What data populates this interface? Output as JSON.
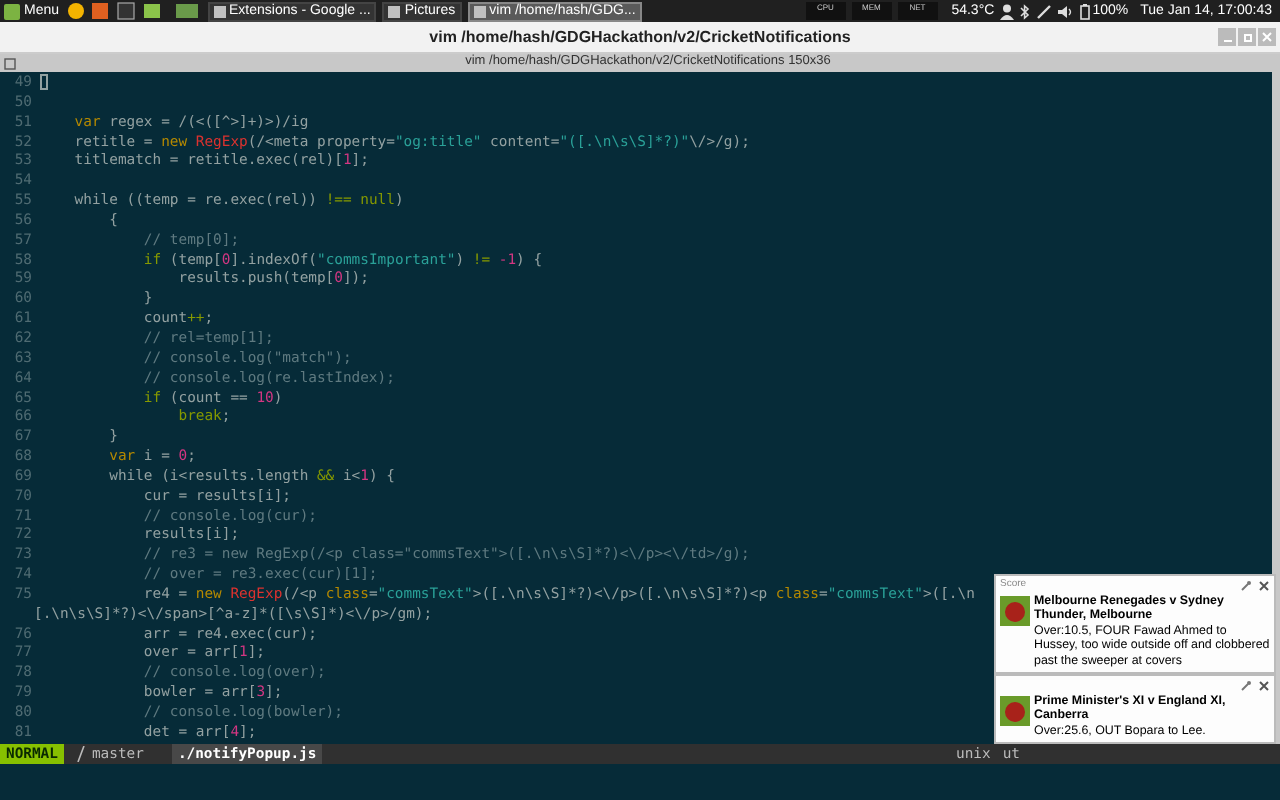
{
  "taskbar": {
    "menu": "Menu",
    "tasks": [
      {
        "label": "Extensions - Google ...",
        "selected": false
      },
      {
        "label": "Pictures",
        "selected": false
      },
      {
        "label": "vim  /home/hash/GDG...",
        "selected": true
      }
    ],
    "monitors": [
      "CPU",
      "MEM",
      "NET"
    ],
    "temperature": "54.3°C",
    "battery": "100%",
    "clock": "Tue Jan 14, 17:00:43"
  },
  "window": {
    "title": "vim  /home/hash/GDGHackathon/v2/CricketNotifications",
    "tab": "vim  /home/hash/GDGHackathon/v2/CricketNotifications 150x36"
  },
  "editor": {
    "rows": [
      {
        "kind": "line",
        "number": "49",
        "cursor": true,
        "tokens": []
      },
      {
        "kind": "line",
        "number": "50",
        "tokens": []
      },
      {
        "kind": "line",
        "number": "51",
        "tokens": [
          {
            "kind": "keyword",
            "text": "    var"
          },
          {
            "kind": "plain",
            "text": " regex = /(<([^>]+)>)/ig"
          }
        ]
      },
      {
        "kind": "line",
        "number": "52",
        "tokens": [
          {
            "kind": "plain",
            "text": "    retitle = "
          },
          {
            "kind": "keyword",
            "text": "new "
          },
          {
            "kind": "type",
            "text": "RegExp"
          },
          {
            "kind": "plain",
            "text": "(/<meta property="
          },
          {
            "kind": "string",
            "text": "\"og:title\""
          },
          {
            "kind": "plain",
            "text": " content="
          },
          {
            "kind": "string",
            "text": "\"([.\\n\\s\\S]*?)\""
          },
          {
            "kind": "plain",
            "text": "\\/>/g);"
          }
        ]
      },
      {
        "kind": "line",
        "number": "53",
        "tokens": [
          {
            "kind": "plain",
            "text": "    titlematch = retitle.exec(rel)["
          },
          {
            "kind": "number",
            "text": "1"
          },
          {
            "kind": "plain",
            "text": "];"
          }
        ]
      },
      {
        "kind": "line",
        "number": "54",
        "tokens": []
      },
      {
        "kind": "line",
        "number": "55",
        "tokens": [
          {
            "kind": "plain",
            "text": "    while ((temp = re.exec(rel)) "
          },
          {
            "kind": "operator",
            "text": "!== "
          },
          {
            "kind": "control",
            "text": "null"
          },
          {
            "kind": "plain",
            "text": ")"
          }
        ]
      },
      {
        "kind": "line",
        "number": "56",
        "tokens": [
          {
            "kind": "plain",
            "text": "        {"
          }
        ]
      },
      {
        "kind": "line",
        "number": "57",
        "tokens": [
          {
            "kind": "comment",
            "text": "            // temp[0];"
          }
        ]
      },
      {
        "kind": "line",
        "number": "58",
        "tokens": [
          {
            "kind": "control",
            "text": "            if"
          },
          {
            "kind": "plain",
            "text": " (temp["
          },
          {
            "kind": "number",
            "text": "0"
          },
          {
            "kind": "plain",
            "text": "].indexOf("
          },
          {
            "kind": "string",
            "text": "\"commsImportant\""
          },
          {
            "kind": "plain",
            "text": ") "
          },
          {
            "kind": "operator",
            "text": "!= "
          },
          {
            "kind": "number",
            "text": "-1"
          },
          {
            "kind": "plain",
            "text": ") {"
          }
        ]
      },
      {
        "kind": "line",
        "number": "59",
        "tokens": [
          {
            "kind": "plain",
            "text": "                results.push(temp["
          },
          {
            "kind": "number",
            "text": "0"
          },
          {
            "kind": "plain",
            "text": "]);"
          }
        ]
      },
      {
        "kind": "line",
        "number": "60",
        "tokens": [
          {
            "kind": "plain",
            "text": "            }"
          }
        ]
      },
      {
        "kind": "line",
        "number": "61",
        "tokens": [
          {
            "kind": "plain",
            "text": "            count"
          },
          {
            "kind": "operator",
            "text": "++"
          },
          {
            "kind": "plain",
            "text": ";"
          }
        ]
      },
      {
        "kind": "line",
        "number": "62",
        "tokens": [
          {
            "kind": "comment",
            "text": "            // rel=temp[1];"
          }
        ]
      },
      {
        "kind": "line",
        "number": "63",
        "tokens": [
          {
            "kind": "comment",
            "text": "            // console.log(\"match\");"
          }
        ]
      },
      {
        "kind": "line",
        "number": "64",
        "tokens": [
          {
            "kind": "comment",
            "text": "            // console.log(re.lastIndex);"
          }
        ]
      },
      {
        "kind": "line",
        "number": "65",
        "tokens": [
          {
            "kind": "control",
            "text": "            if"
          },
          {
            "kind": "plain",
            "text": " (count == "
          },
          {
            "kind": "number",
            "text": "10"
          },
          {
            "kind": "plain",
            "text": ")"
          }
        ]
      },
      {
        "kind": "line",
        "number": "66",
        "tokens": [
          {
            "kind": "control",
            "text": "                break"
          },
          {
            "kind": "plain",
            "text": ";"
          }
        ]
      },
      {
        "kind": "line",
        "number": "67",
        "tokens": [
          {
            "kind": "plain",
            "text": "        }"
          }
        ]
      },
      {
        "kind": "line",
        "number": "68",
        "tokens": [
          {
            "kind": "keyword",
            "text": "        var"
          },
          {
            "kind": "plain",
            "text": " i = "
          },
          {
            "kind": "number",
            "text": "0"
          },
          {
            "kind": "plain",
            "text": ";"
          }
        ]
      },
      {
        "kind": "line",
        "number": "69",
        "tokens": [
          {
            "kind": "plain",
            "text": "        while (i<results.length "
          },
          {
            "kind": "operator",
            "text": "&&"
          },
          {
            "kind": "plain",
            "text": " i<"
          },
          {
            "kind": "number",
            "text": "1"
          },
          {
            "kind": "plain",
            "text": ") {"
          }
        ]
      },
      {
        "kind": "line",
        "number": "70",
        "tokens": [
          {
            "kind": "plain",
            "text": "            cur = results[i];"
          }
        ]
      },
      {
        "kind": "line",
        "number": "71",
        "tokens": [
          {
            "kind": "comment",
            "text": "            // console.log(cur);"
          }
        ]
      },
      {
        "kind": "line",
        "number": "72",
        "tokens": [
          {
            "kind": "plain",
            "text": "            results[i];"
          }
        ]
      },
      {
        "kind": "line",
        "number": "73",
        "tokens": [
          {
            "kind": "comment",
            "text": "            // re3 = new RegExp(/<p class=\"commsText\">([.\\n\\s\\S]*?)<\\/p><\\/td>/g);"
          }
        ]
      },
      {
        "kind": "line",
        "number": "74",
        "tokens": [
          {
            "kind": "comment",
            "text": "            // over = re3.exec(cur)[1];"
          }
        ]
      },
      {
        "kind": "line",
        "number": "75",
        "tokens": [
          {
            "kind": "plain",
            "text": "            re4 = "
          },
          {
            "kind": "keyword",
            "text": "new "
          },
          {
            "kind": "type",
            "text": "RegExp"
          },
          {
            "kind": "plain",
            "text": "(/<p "
          },
          {
            "kind": "keyword",
            "text": "class"
          },
          {
            "kind": "plain",
            "text": "="
          },
          {
            "kind": "string",
            "text": "\"commsText\""
          },
          {
            "kind": "plain",
            "text": ">([.\\n\\s\\S]*?)<\\/p>([.\\n\\s\\S]*?)<p "
          },
          {
            "kind": "keyword",
            "text": "class"
          },
          {
            "kind": "plain",
            "text": "="
          },
          {
            "kind": "string",
            "text": "\"commsText\""
          },
          {
            "kind": "plain",
            "text": ">([.\\n"
          }
        ]
      },
      {
        "kind": "wrap",
        "tokens": [
          {
            "kind": "plain",
            "text": "[.\\n\\s\\S]*?)<\\/span>[^a-z]*([\\s\\S]*)<\\/p>/gm);"
          }
        ]
      },
      {
        "kind": "line",
        "number": "76",
        "tokens": [
          {
            "kind": "plain",
            "text": "            arr = re4.exec(cur);"
          }
        ]
      },
      {
        "kind": "line",
        "number": "77",
        "tokens": [
          {
            "kind": "plain",
            "text": "            over = arr["
          },
          {
            "kind": "number",
            "text": "1"
          },
          {
            "kind": "plain",
            "text": "];"
          }
        ]
      },
      {
        "kind": "line",
        "number": "78",
        "tokens": [
          {
            "kind": "comment",
            "text": "            // console.log(over);"
          }
        ]
      },
      {
        "kind": "line",
        "number": "79",
        "tokens": [
          {
            "kind": "plain",
            "text": "            bowler = arr["
          },
          {
            "kind": "number",
            "text": "3"
          },
          {
            "kind": "plain",
            "text": "];"
          }
        ]
      },
      {
        "kind": "line",
        "number": "80",
        "tokens": [
          {
            "kind": "comment",
            "text": "            // console.log(bowler);"
          }
        ]
      },
      {
        "kind": "line",
        "number": "81",
        "tokens": [
          {
            "kind": "plain",
            "text": "            det = arr["
          },
          {
            "kind": "number",
            "text": "4"
          },
          {
            "kind": "plain",
            "text": "];"
          }
        ]
      }
    ]
  },
  "status_line": {
    "mode": "NORMAL",
    "branch": "master",
    "file": "./notifyPopup.js",
    "format": "unix",
    "encoding": "ut"
  },
  "notifications": [
    {
      "header": "Score",
      "title": "Melbourne Renegades v Sydney Thunder, Melbourne",
      "body": "Over:10.5, FOUR Fawad Ahmed to Hussey, too wide outside off and clobbered past the sweeper at covers"
    },
    {
      "title": "Prime Minister's XI v England XI, Canberra",
      "body": "Over:25.6, OUT Bopara to Lee."
    }
  ]
}
